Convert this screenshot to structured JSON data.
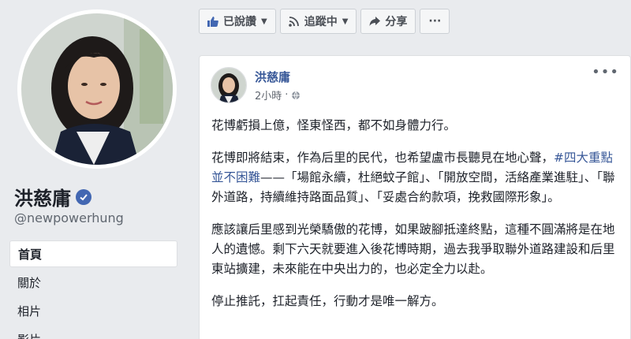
{
  "profile": {
    "name": "洪慈庸",
    "handle": "@newpowerhung"
  },
  "nav": {
    "items": [
      {
        "label": "首頁",
        "active": true
      },
      {
        "label": "關於",
        "active": false
      },
      {
        "label": "相片",
        "active": false
      },
      {
        "label": "影片",
        "active": false
      }
    ]
  },
  "actions": {
    "liked": "已說讚",
    "following": "追蹤中",
    "share": "分享",
    "more": "···"
  },
  "post": {
    "author": "洪慈庸",
    "time": "2小時",
    "more": "•••",
    "p1": "花博虧損上億，怪東怪西，都不如身體力行。",
    "p2_pre": "花博即將結束，作為后里的民代，也希望盧市長聽見在地心聲，",
    "p2_tag": "#四大重點並不困難",
    "p2_post": "——「場館永續，杜絕蚊子館」、「開放空間，活絡產業進駐」、「聯外道路，持續維持路面品質」、「妥處合約款項，挽救國際形象」。",
    "p3": "應該讓后里感到光榮驕傲的花博，如果跛腳抵達終點，這種不圓滿將是在地人的遺憾。剩下六天就要進入後花博時期，過去我爭取聯外道路建設和后里東站擴建，未來能在中央出力的，也必定全力以赴。",
    "p4": "停止推託，扛起責任，行動才是唯一解方。"
  }
}
